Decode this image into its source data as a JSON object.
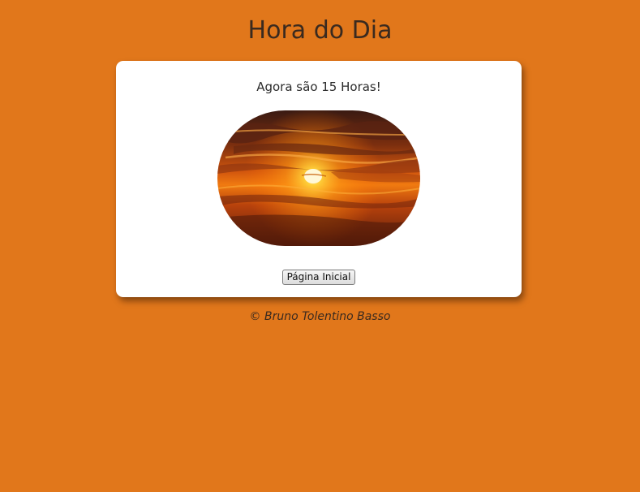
{
  "page": {
    "title": "Hora do Dia",
    "background_color": "#e1771b"
  },
  "card": {
    "message": "Agora são 15 Horas!",
    "image": {
      "subject": "sunset-sky",
      "shape": "rounded"
    },
    "button_label": "Página Inicial"
  },
  "footer": {
    "text": "© Bruno Tolentino Basso"
  }
}
